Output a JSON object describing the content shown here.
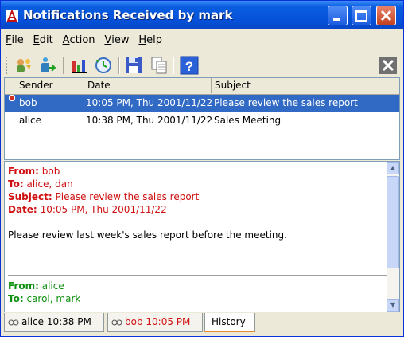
{
  "window": {
    "title": "Notifications Received by mark"
  },
  "menu": [
    {
      "label": "File",
      "key": "F",
      "rest": "ile"
    },
    {
      "label": "Edit",
      "key": "E",
      "rest": "dit"
    },
    {
      "label": "Action",
      "key": "A",
      "rest": "ction"
    },
    {
      "label": "View",
      "key": "V",
      "rest": "iew"
    },
    {
      "label": "Help",
      "key": "H",
      "rest": "elp"
    }
  ],
  "list": {
    "columns": [
      "Sender",
      "Date",
      "Subject"
    ],
    "rows": [
      {
        "sender": "bob",
        "date": "10:05 PM, Thu 2001/11/22",
        "subject": "Please review the sales report"
      },
      {
        "sender": "alice",
        "date": "10:38 PM, Thu 2001/11/22",
        "subject": "Sales Meeting"
      }
    ]
  },
  "message1": {
    "from_label": "From:",
    "from": "bob",
    "to_label": "To:",
    "to": "alice, dan",
    "subject_label": "Subject:",
    "subject": "Please review the sales report",
    "date_label": "Date:",
    "date": "10:05 PM, Thu 2001/11/22",
    "body": "Please review last week's sales report before the meeting."
  },
  "message2": {
    "from_label": "From:",
    "from": "alice",
    "to_label": "To:",
    "to": "carol, mark"
  },
  "tabs": [
    {
      "label": "alice 10:38 PM"
    },
    {
      "label": "bob 10:05 PM"
    },
    {
      "label": "History"
    }
  ],
  "colors": {
    "titlebar": "#0550d8",
    "selection": "#316ac5",
    "unread_text": "#d01010",
    "read_text": "#109010"
  }
}
